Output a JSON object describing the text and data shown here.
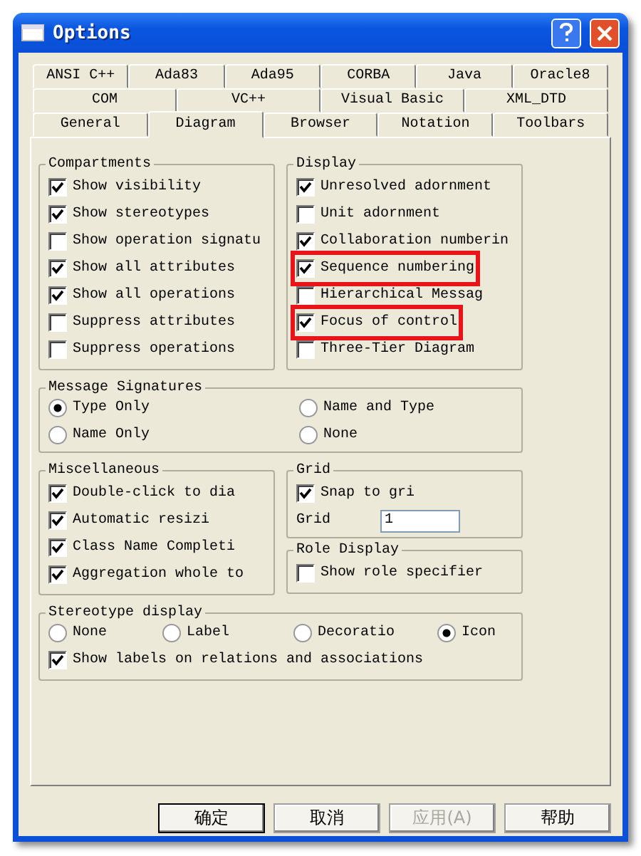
{
  "window": {
    "title": "Options"
  },
  "tab_rows": [
    {
      "tabs": [
        {
          "label": "ANSI C++",
          "selected": false
        },
        {
          "label": "Ada83",
          "selected": false
        },
        {
          "label": "Ada95",
          "selected": false
        },
        {
          "label": "CORBA",
          "selected": false
        },
        {
          "label": "Java",
          "selected": false
        },
        {
          "label": "Oracle8",
          "selected": false
        }
      ]
    },
    {
      "tabs": [
        {
          "label": "COM",
          "selected": false
        },
        {
          "label": "VC++",
          "selected": false
        },
        {
          "label": "Visual Basic",
          "selected": false
        },
        {
          "label": "XML_DTD",
          "selected": false
        }
      ]
    },
    {
      "tabs": [
        {
          "label": "General",
          "selected": false
        },
        {
          "label": "Diagram",
          "selected": true
        },
        {
          "label": "Browser",
          "selected": false
        },
        {
          "label": "Notation",
          "selected": false
        },
        {
          "label": "Toolbars",
          "selected": false
        }
      ]
    }
  ],
  "compartments": {
    "title": "Compartments",
    "items": [
      {
        "label": "Show visibility",
        "checked": true
      },
      {
        "label": "Show stereotypes",
        "checked": true
      },
      {
        "label": "Show operation signatu",
        "checked": false
      },
      {
        "label": "Show all attributes",
        "checked": true
      },
      {
        "label": "Show all operations",
        "checked": true
      },
      {
        "label": "Suppress attributes",
        "checked": false
      },
      {
        "label": "Suppress operations",
        "checked": false
      }
    ]
  },
  "display": {
    "title": "Display",
    "items": [
      {
        "label": "Unresolved adornment",
        "checked": true,
        "highlighted": false
      },
      {
        "label": "Unit adornment",
        "checked": false,
        "highlighted": false
      },
      {
        "label": "Collaboration numberin",
        "checked": true,
        "highlighted": false
      },
      {
        "label": "Sequence numbering",
        "checked": true,
        "highlighted": true
      },
      {
        "label": "Hierarchical Messag",
        "checked": false,
        "highlighted": false
      },
      {
        "label": "Focus of control",
        "checked": true,
        "highlighted": true
      },
      {
        "label": "Three-Tier Diagram",
        "checked": false,
        "highlighted": false
      }
    ]
  },
  "message_signatures": {
    "title": "Message Signatures",
    "options": [
      {
        "label": "Type Only",
        "selected": true
      },
      {
        "label": "Name and Type",
        "selected": false
      },
      {
        "label": "Name Only",
        "selected": false
      },
      {
        "label": "None",
        "selected": false
      }
    ]
  },
  "miscellaneous": {
    "title": "Miscellaneous",
    "items": [
      {
        "label": "Double-click to dia",
        "checked": true
      },
      {
        "label": "Automatic resizi",
        "checked": true
      },
      {
        "label": "Class Name Completi",
        "checked": true
      },
      {
        "label": "Aggregation whole to",
        "checked": true
      }
    ]
  },
  "grid": {
    "title": "Grid",
    "snap": {
      "label": "Snap to gri",
      "checked": true
    },
    "size_label": "Grid",
    "size_value": "1"
  },
  "role_display": {
    "title": "Role Display",
    "items": [
      {
        "label": "Show role specifier",
        "checked": false
      }
    ]
  },
  "stereotype_display": {
    "title": "Stereotype display",
    "options": [
      {
        "label": "None",
        "selected": false
      },
      {
        "label": "Label",
        "selected": false
      },
      {
        "label": "Decoratio",
        "selected": false
      },
      {
        "label": "Icon",
        "selected": true
      }
    ],
    "show_labels": {
      "label": "Show labels on relations and associations",
      "checked": true
    }
  },
  "buttons": [
    {
      "label": "确定",
      "default": true,
      "disabled": false
    },
    {
      "label": "取消",
      "default": false,
      "disabled": false
    },
    {
      "label": "应用(A)",
      "default": false,
      "disabled": true
    },
    {
      "label": "帮助",
      "default": false,
      "disabled": false
    }
  ]
}
